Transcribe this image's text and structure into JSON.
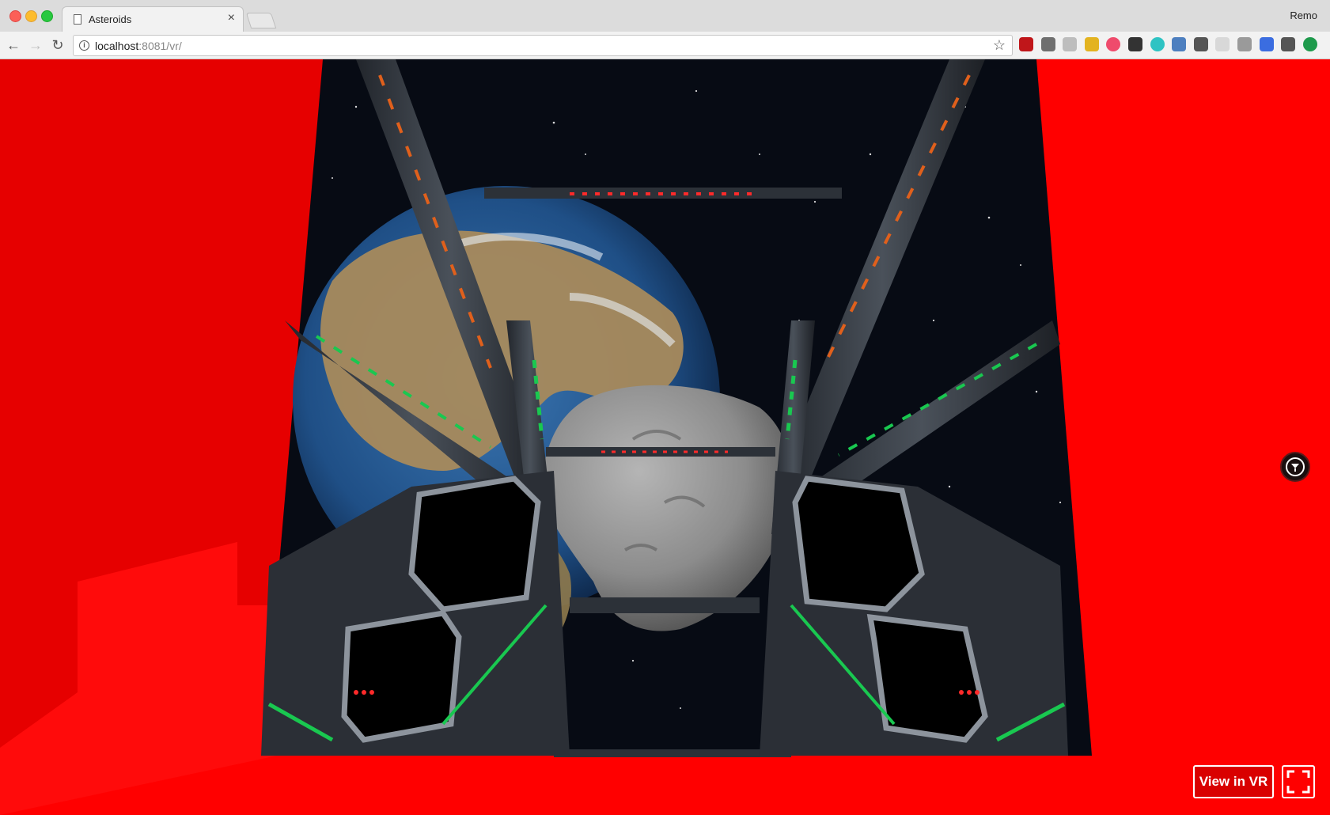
{
  "browser": {
    "tab_title": "Asteroids",
    "tab_close": "×",
    "profile_name": "Remo",
    "url_host": "localhost",
    "url_rest": ":8081/vr/",
    "nav": {
      "back": "←",
      "forward": "→",
      "reload": "↻"
    },
    "star": "☆",
    "extensions": [
      {
        "name": "ublock-icon",
        "color": "#c0161a"
      },
      {
        "name": "glasses-outline-icon",
        "color": "#6f6f6f"
      },
      {
        "name": "chat-icon",
        "color": "#bdbdbd"
      },
      {
        "name": "broom-icon",
        "color": "#e3b320"
      },
      {
        "name": "heart-extension-icon",
        "color": "#ef4b6c"
      },
      {
        "name": "mask-icon",
        "color": "#333333"
      },
      {
        "name": "m-extension-icon",
        "color": "#2ec3c3"
      },
      {
        "name": "screen-icon",
        "color": "#4d7fbf"
      },
      {
        "name": "shield-extension-icon",
        "color": "#555555"
      },
      {
        "name": "circle-extension-icon",
        "color": "#d8d8d8"
      },
      {
        "name": "grid-extension-icon",
        "color": "#9a9a9a"
      },
      {
        "name": "bookmark-extension-icon",
        "color": "#3b6de0"
      },
      {
        "name": "info-extension-icon",
        "color": "#555555"
      },
      {
        "name": "upload-extension-icon",
        "color": "#1e9a4c"
      }
    ]
  },
  "scene": {
    "vr_button_label": "View in VR",
    "colors": {
      "background": "#ff0000",
      "background_shade": "#e00000",
      "space": "#070b14",
      "earth_ocean": "#1f4f86",
      "earth_land": "#a88a5c",
      "asteroid": "#8c8c8c",
      "frame": "#3a4048",
      "accent_orange": "#e0601c",
      "accent_green": "#19c850",
      "accent_red": "#ff2a2a"
    }
  }
}
